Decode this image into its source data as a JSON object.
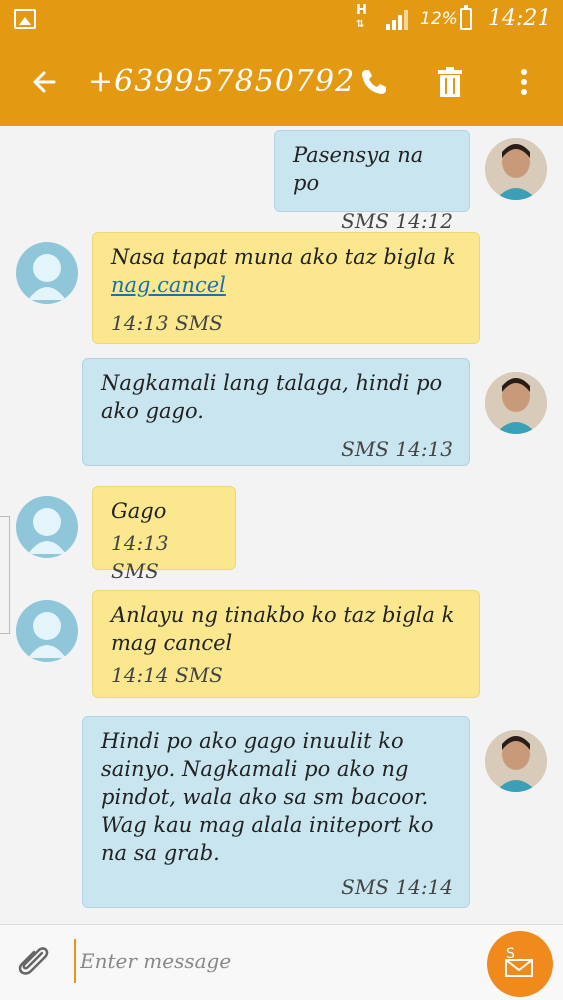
{
  "status_bar": {
    "network": "H",
    "battery_percent": "12%",
    "time": "14:21"
  },
  "header": {
    "contact": "+639957850792",
    "icons": [
      "back-arrow-icon",
      "phone-icon",
      "trash-icon",
      "more-vert-icon"
    ]
  },
  "messages": [
    {
      "direction": "sent",
      "text": "Pasensya na po",
      "meta": "SMS 14:12"
    },
    {
      "direction": "received",
      "text": "Nasa tapat muna ako taz bigla k ",
      "link": "nag.cancel",
      "meta": "14:13 SMS"
    },
    {
      "direction": "sent",
      "text": "Nagkamali lang talaga, hindi po ako gago.",
      "meta": "SMS 14:13"
    },
    {
      "direction": "received",
      "text": "Gago",
      "meta": "14:13 SMS"
    },
    {
      "direction": "received",
      "text": "Anlayu ng tinakbo ko taz bigla k mag cancel",
      "meta": "14:14 SMS"
    },
    {
      "direction": "sent",
      "text": "Hindi po ako gago inuulit ko sainyo. Nagkamali po ako ng pindot, wala ako sa sm bacoor. Wag kau mag alala initeport ko na sa grab.",
      "meta": "SMS 14:14"
    }
  ],
  "compose": {
    "placeholder": "Enter message",
    "send_label": "S"
  },
  "colors": {
    "accent": "#e39a12",
    "sent_bubble": "#c9e6f0",
    "received_bubble": "#fbe88e",
    "send_button": "#f08a1c"
  }
}
